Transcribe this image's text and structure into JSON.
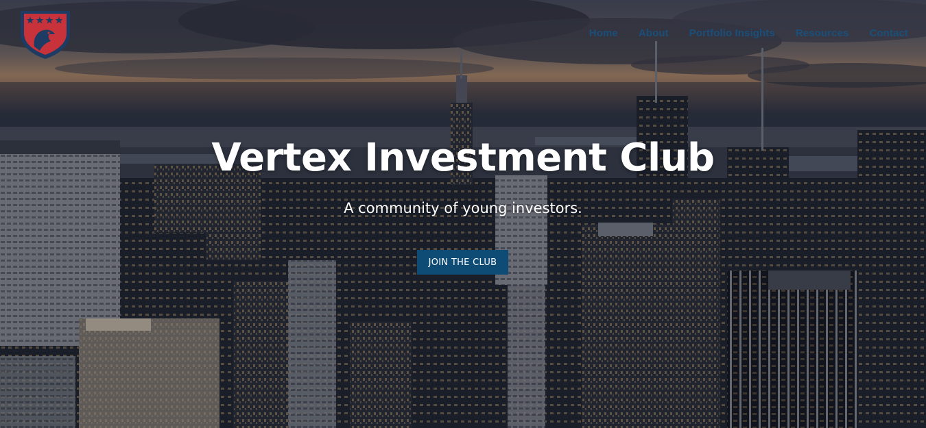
{
  "site": {
    "logo_icon": "eagle-shield-icon",
    "colors": {
      "nav_link": "#1a4f7a",
      "cta_background": "#0f4c75",
      "cta_text": "#ffffff",
      "hero_text": "#ffffff",
      "logo_red": "#c8323a",
      "logo_navy": "#1d3b63"
    }
  },
  "nav": {
    "items": [
      {
        "label": "Home"
      },
      {
        "label": "About"
      },
      {
        "label": "Portfolio Insights"
      },
      {
        "label": "Resources"
      },
      {
        "label": "Contact"
      }
    ]
  },
  "hero": {
    "title": "Vertex Investment Club",
    "subtitle": "A community of young investors.",
    "cta_label": "JOIN THE CLUB"
  }
}
